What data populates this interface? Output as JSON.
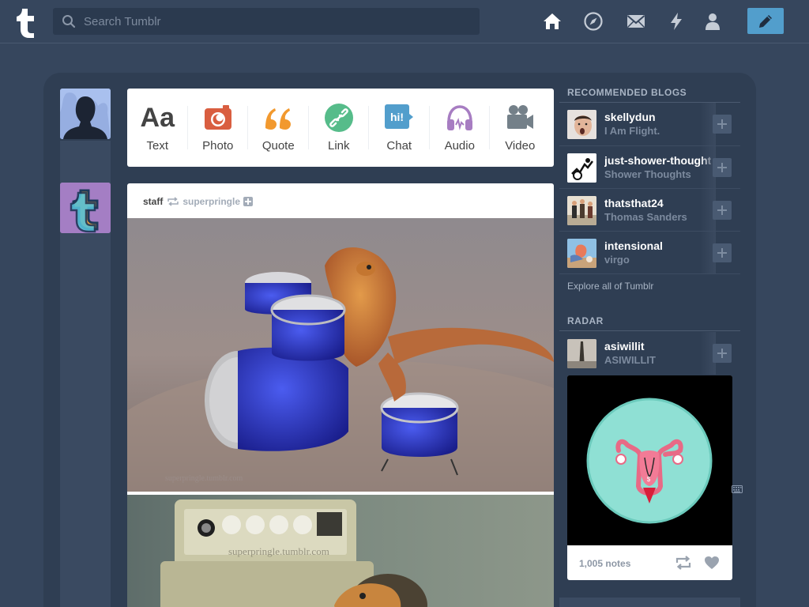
{
  "header": {
    "search_placeholder": "Search Tumblr",
    "nav": [
      "home-icon",
      "explore-icon",
      "inbox-icon",
      "activity-icon",
      "account-icon"
    ],
    "compose": "compose-icon",
    "accent": "#529ecc",
    "background": "#36465d"
  },
  "post_types": [
    {
      "label": "Text",
      "icon": "text-icon",
      "color": "#444444"
    },
    {
      "label": "Photo",
      "icon": "camera-icon",
      "color": "#d95e40"
    },
    {
      "label": "Quote",
      "icon": "quote-icon",
      "color": "#f2992e"
    },
    {
      "label": "Link",
      "icon": "link-icon",
      "color": "#56bc8a"
    },
    {
      "label": "Chat",
      "icon": "chat-icon",
      "color": "#529ecc"
    },
    {
      "label": "Audio",
      "icon": "headphones-icon",
      "color": "#a77dc2"
    },
    {
      "label": "Video",
      "icon": "video-camera-icon",
      "color": "#748089"
    }
  ],
  "post": {
    "author": "staff",
    "reblogged_from": "superpringle",
    "photo1_watermark": "superpringle.tumblr.com",
    "photo2_watermark": "superpringle.tumblr.com"
  },
  "sidebar": {
    "recommended_title": "RECOMMENDED BLOGS",
    "blogs": [
      {
        "name": "skellydun",
        "title": "I Am Flight."
      },
      {
        "name": "just-shower-thoughts",
        "title": "Shower Thoughts"
      },
      {
        "name": "thatsthat24",
        "title": "Thomas Sanders"
      },
      {
        "name": "intensional",
        "title": "virgo"
      }
    ],
    "explore_link": "Explore all of Tumblr",
    "radar_title": "RADAR",
    "radar_blog": {
      "name": "asiwillit",
      "title": "ASIWILLIT"
    },
    "radar_notes": "1,005 notes"
  }
}
